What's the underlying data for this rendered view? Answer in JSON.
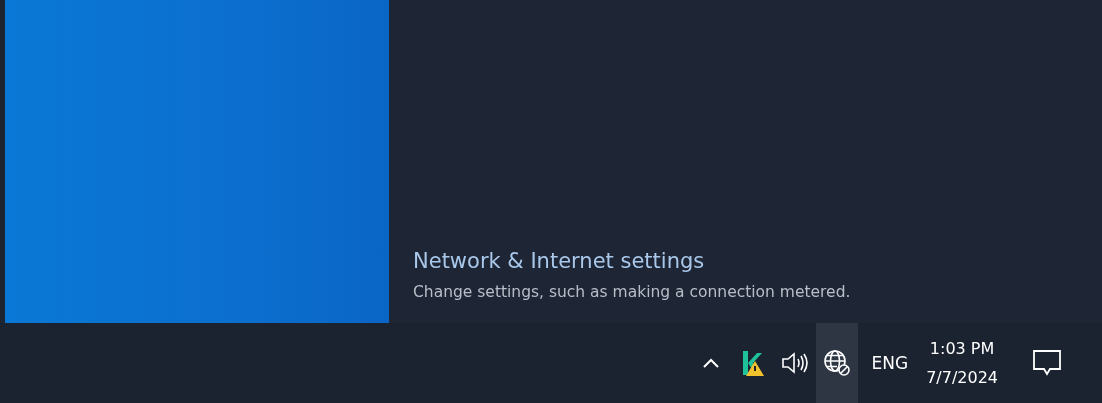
{
  "flyout": {
    "title": "Network & Internet settings",
    "description": "Change settings, such as making a connection metered."
  },
  "taskbar": {
    "tray": [
      {
        "kind": "chevron",
        "selected": false
      },
      {
        "kind": "app",
        "selected": false
      },
      {
        "kind": "volume",
        "selected": false
      },
      {
        "kind": "network",
        "selected": true
      }
    ],
    "language": "ENG",
    "time": "1:03 PM",
    "date": "7/7/2024"
  }
}
